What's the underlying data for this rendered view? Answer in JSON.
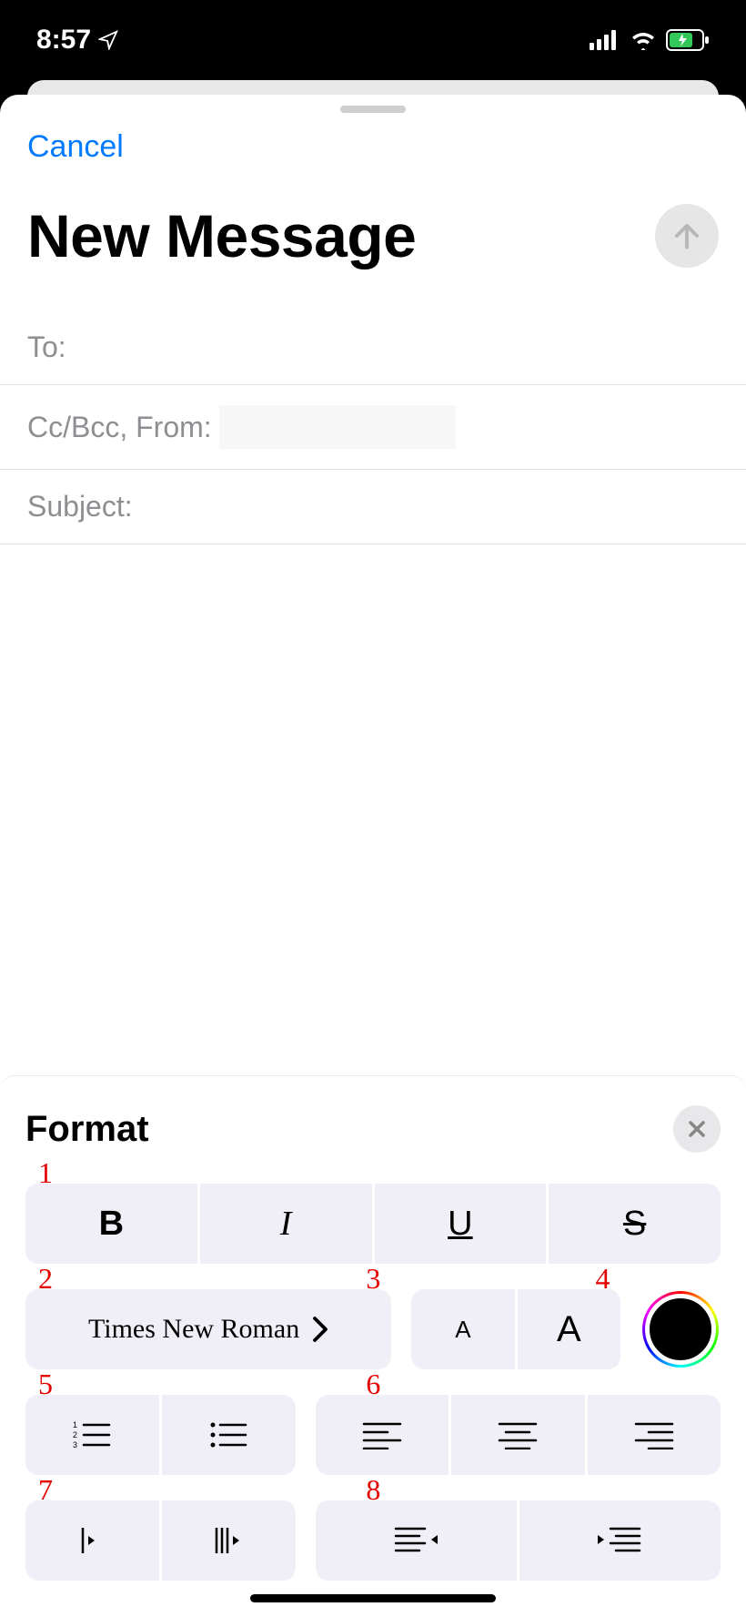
{
  "status": {
    "time": "8:57"
  },
  "compose": {
    "cancel": "Cancel",
    "title": "New Message",
    "fields": {
      "to": "To:",
      "ccbcc": "Cc/Bcc, From:",
      "subject": "Subject:"
    }
  },
  "format": {
    "title": "Format",
    "annotations": [
      "1",
      "2",
      "3",
      "4",
      "5",
      "6",
      "7",
      "8"
    ],
    "style": {
      "bold": "B",
      "italic": "I",
      "underline": "U",
      "strike": "S"
    },
    "font": {
      "name": "Times New Roman",
      "size_small": "A",
      "size_big": "A"
    }
  }
}
